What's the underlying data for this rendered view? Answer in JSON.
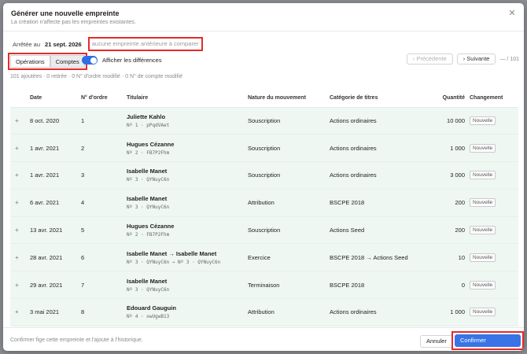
{
  "modal": {
    "title": "Générer une nouvelle empreinte",
    "subtitle": "La création n'affecte pas les empreintes existantes.",
    "close_glyph": "✕"
  },
  "arrete": {
    "label": "Arrêtée au",
    "date": "21 sept. 2026",
    "no_previous": "aucune empreinte antérieure à comparer"
  },
  "tabs": [
    {
      "label": "Opérations",
      "active": false
    },
    {
      "label": "Comptes",
      "active": true
    }
  ],
  "toggle": {
    "label": "Afficher les différences",
    "on": true
  },
  "pager": {
    "prev": "‹  Précédente",
    "next": "›  Suivante",
    "count": "— / 101"
  },
  "summary": "101 ajoutées · 0 retirée · 0 N° d'ordre modifié · 0 N° de compte modifié",
  "table": {
    "headers": [
      "",
      "Date",
      "N° d'ordre",
      "Titulaire",
      "Nature du mouvement",
      "Catégorie de titres",
      "Quantité",
      "Changement"
    ],
    "rows": [
      {
        "marker": "+",
        "date": "8 oct. 2020",
        "ordre": "1",
        "titulaire": "Juliette Kahlo",
        "compte": "Nº 1 · pPqdVAet",
        "nature": "Souscription",
        "categorie": "Actions ordinaires",
        "quantite": "10 000",
        "changement": "Nouvelle"
      },
      {
        "marker": "+",
        "date": "1 avr. 2021",
        "ordre": "2",
        "titulaire": "Hugues Cézanne",
        "compte": "Nº 2 · FB7P2Fhm",
        "nature": "Souscription",
        "categorie": "Actions ordinaires",
        "quantite": "1 000",
        "changement": "Nouvelle"
      },
      {
        "marker": "+",
        "date": "1 avr. 2021",
        "ordre": "3",
        "titulaire": "Isabelle Manet",
        "compte": "Nº 3 · QYNuyC6n",
        "nature": "Souscription",
        "categorie": "Actions ordinaires",
        "quantite": "3 000",
        "changement": "Nouvelle"
      },
      {
        "marker": "+",
        "date": "6 avr. 2021",
        "ordre": "4",
        "titulaire": "Isabelle Manet",
        "compte": "Nº 3 · QYNuyC6n",
        "nature": "Attribution",
        "categorie": "BSCPE 2018",
        "quantite": "200",
        "changement": "Nouvelle"
      },
      {
        "marker": "+",
        "date": "13 avr. 2021",
        "ordre": "5",
        "titulaire": "Hugues Cézanne",
        "compte": "Nº 2 · FB7P2Fhm",
        "nature": "Souscription",
        "categorie": "Actions Seed",
        "quantite": "200",
        "changement": "Nouvelle"
      },
      {
        "marker": "+",
        "date": "28 avr. 2021",
        "ordre": "6",
        "titulaire": "Isabelle Manet → Isabelle Manet",
        "compte": "Nº 3 · QYNuyC6n → Nº 3 · QYNuyC6n",
        "nature": "Exercice",
        "categorie": "BSCPE 2018 → Actions Seed",
        "quantite": "10",
        "changement": "Nouvelle"
      },
      {
        "marker": "+",
        "date": "29 avr. 2021",
        "ordre": "7",
        "titulaire": "Isabelle Manet",
        "compte": "Nº 3 · QYNuyC6n",
        "nature": "Terminaison",
        "categorie": "BSCPE 2018",
        "quantite": "0",
        "changement": "Nouvelle"
      },
      {
        "marker": "+",
        "date": "3 mai 2021",
        "ordre": "8",
        "titulaire": "Edouard Gauguin",
        "compte": "Nº 4 · owUgwB13",
        "nature": "Attribution",
        "categorie": "Actions ordinaires",
        "quantite": "1 000",
        "changement": "Nouvelle"
      }
    ]
  },
  "footer": {
    "text": "Confirmer fige cette empreinte et l'ajoute à l'historique.",
    "cancel": "Annuler",
    "confirm": "Confirmer l'empreinte"
  },
  "colors": {
    "accent": "#3a73e5",
    "row_added": "#eef7f2",
    "highlight": "#e32b2b"
  }
}
